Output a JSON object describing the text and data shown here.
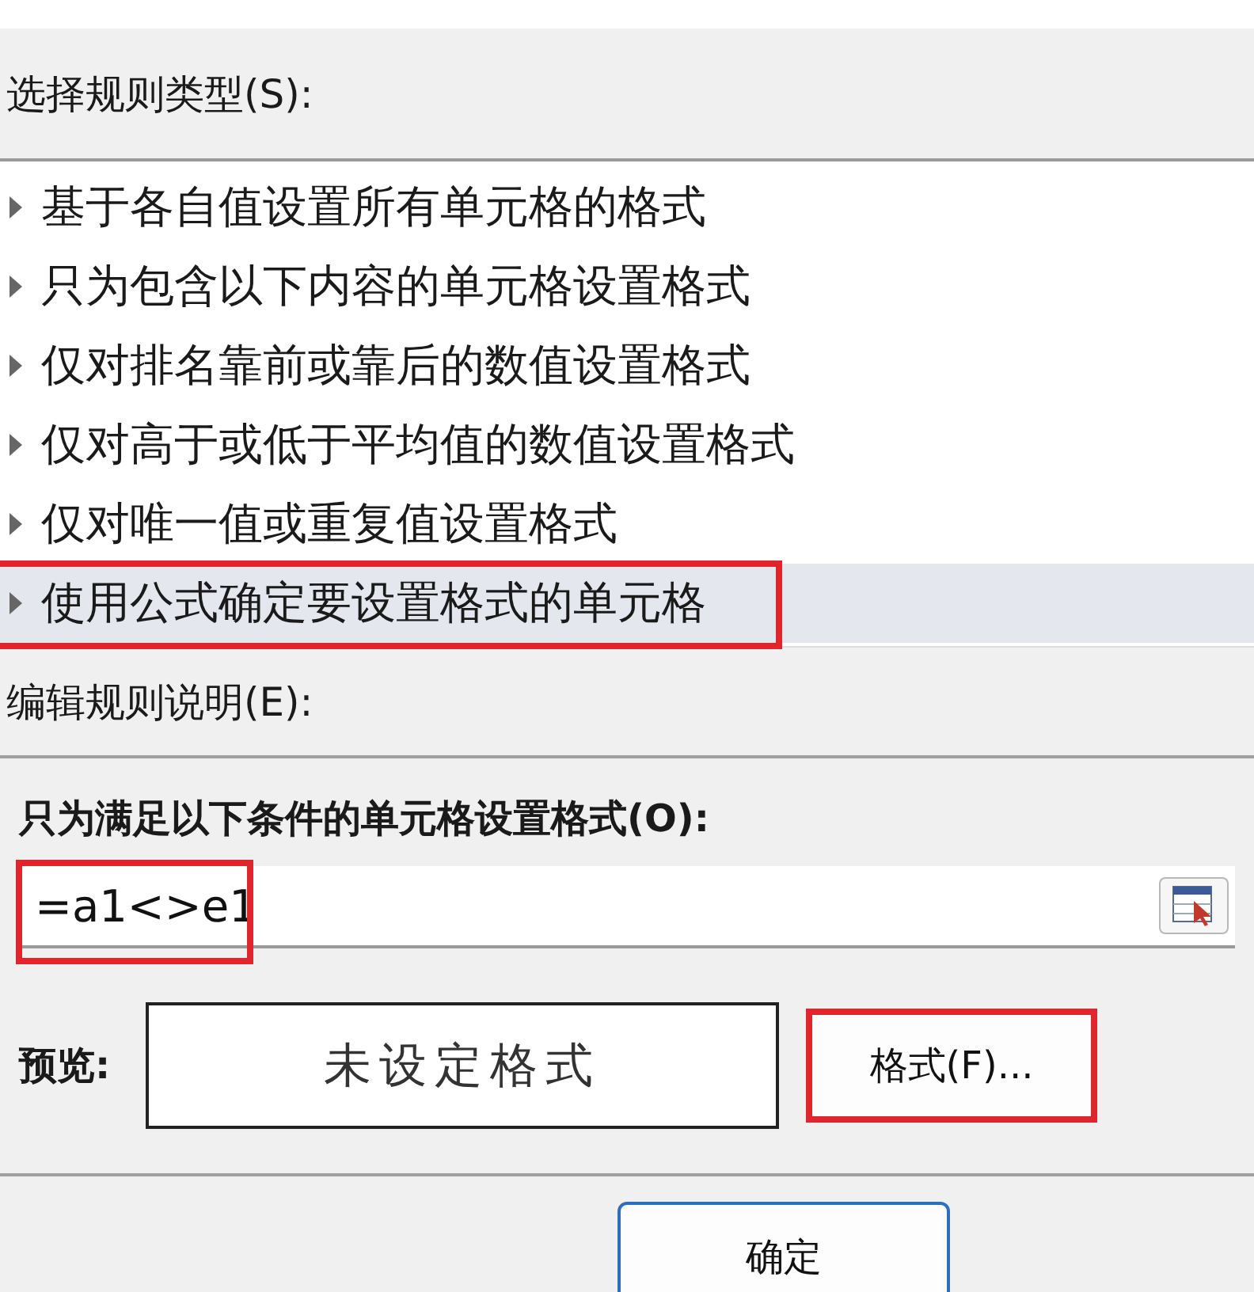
{
  "rule_type_label": "选择规则类型(S):",
  "rule_types": [
    {
      "label": "基于各自值设置所有单元格的格式",
      "selected": false,
      "highlighted": false
    },
    {
      "label": "只为包含以下内容的单元格设置格式",
      "selected": false,
      "highlighted": false
    },
    {
      "label": "仅对排名靠前或靠后的数值设置格式",
      "selected": false,
      "highlighted": false
    },
    {
      "label": "仅对高于或低于平均值的数值设置格式",
      "selected": false,
      "highlighted": false
    },
    {
      "label": "仅对唯一值或重复值设置格式",
      "selected": false,
      "highlighted": false
    },
    {
      "label": "使用公式确定要设置格式的单元格",
      "selected": true,
      "highlighted": true
    }
  ],
  "edit_label": "编辑规则说明(E):",
  "condition_label": "只为满足以下条件的单元格设置格式(O):",
  "formula": {
    "value": "=a1<>e1",
    "highlighted": true
  },
  "preview_label": "预览:",
  "preview_text": "未设定格式",
  "format_button": {
    "label": "格式(F)...",
    "highlighted": true
  },
  "ok_button": "确定"
}
